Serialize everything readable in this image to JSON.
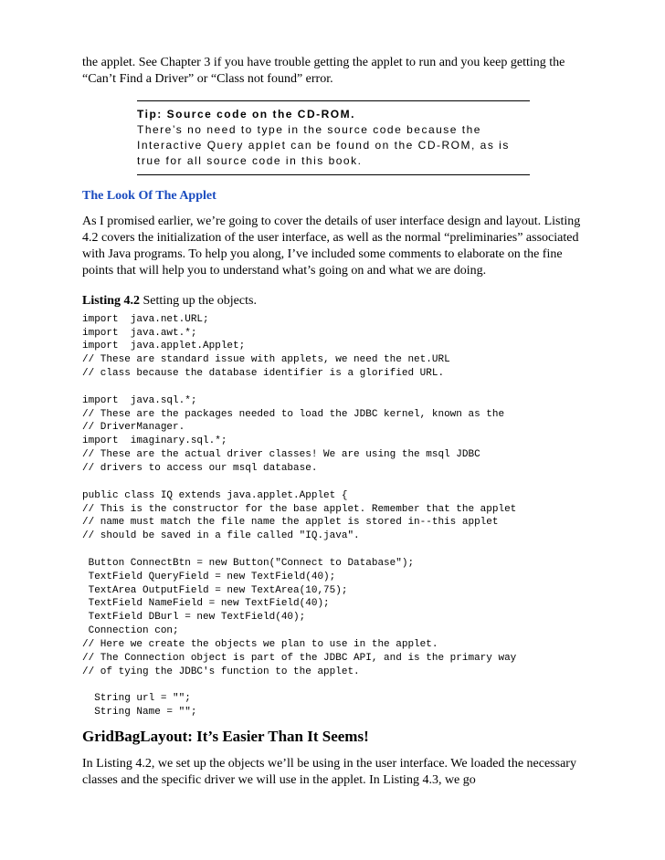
{
  "intro_para": "the applet. See Chapter 3 if you have trouble getting the applet to run and you keep getting the “Can’t Find a Driver” or “Class not found” error.",
  "tip": {
    "title": "Tip:  Source code on the CD-ROM.",
    "body": "There’s no need to type in the source code because the Interactive Query applet can be found on the CD-ROM, as is true for all source code in this book."
  },
  "section1": {
    "heading": "The Look Of The Applet",
    "para": "As I promised earlier, we’re going to cover the details of user interface design and layout. Listing 4.2 covers the initialization of the user interface, as well as the normal “preliminaries” associated with Java programs. To help you along, I’ve included some comments to elaborate on the fine points that will help you to understand what’s going on and what we are doing."
  },
  "listing": {
    "label_bold": "Listing 4.2",
    "label_rest": " Setting up the objects.",
    "code": "import  java.net.URL;\nimport  java.awt.*;\nimport  java.applet.Applet;\n// These are standard issue with applets, we need the net.URL\n// class because the database identifier is a glorified URL.\n\nimport  java.sql.*;\n// These are the packages needed to load the JDBC kernel, known as the\n// DriverManager.\nimport  imaginary.sql.*;\n// These are the actual driver classes! We are using the msql JDBC\n// drivers to access our msql database.\n\npublic class IQ extends java.applet.Applet {\n// This is the constructor for the base applet. Remember that the applet\n// name must match the file name the applet is stored in--this applet\n// should be saved in a file called \"IQ.java\".\n\n Button ConnectBtn = new Button(\"Connect to Database\");\n TextField QueryField = new TextField(40);\n TextArea OutputField = new TextArea(10,75);\n TextField NameField = new TextField(40);\n TextField DBurl = new TextField(40);\n Connection con;\n// Here we create the objects we plan to use in the applet.\n// The Connection object is part of the JDBC API, and is the primary way\n// of tying the JDBC's function to the applet.\n\n  String url = \"\";\n  String Name = \"\";"
  },
  "section2": {
    "heading": "GridBagLayout: It’s Easier Than It Seems!",
    "para": "In Listing 4.2, we set up the objects we’ll be using in the user interface. We loaded the necessary classes and the specific driver we will use in the applet. In Listing 4.3, we go"
  }
}
